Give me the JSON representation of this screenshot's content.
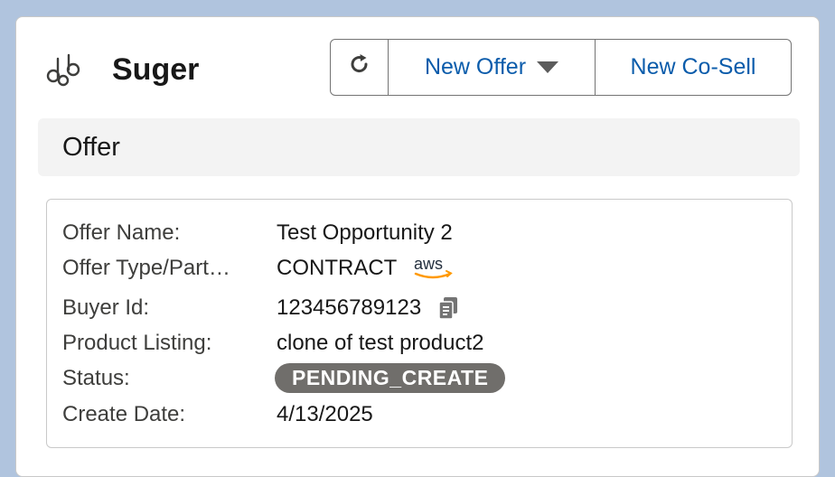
{
  "app": {
    "title": "Suger",
    "logo_icon": "suger-logo-icon"
  },
  "toolbar": {
    "refresh_icon": "refresh-icon",
    "new_offer_label": "New Offer",
    "new_offer_dropdown_icon": "caret-down-icon",
    "new_cosell_label": "New Co-Sell"
  },
  "section": {
    "title": "Offer"
  },
  "details": {
    "offer_name_label": "Offer Name:",
    "offer_name_value": "Test Opportunity 2",
    "offer_type_label": "Offer Type/Part…",
    "offer_type_value": "CONTRACT",
    "partner_logo": "aws-logo-icon",
    "buyer_id_label": "Buyer Id:",
    "buyer_id_value": "123456789123",
    "copy_icon": "copy-icon",
    "product_listing_label": "Product Listing:",
    "product_listing_value": "clone of test product2",
    "status_label": "Status:",
    "status_value": "PENDING_CREATE",
    "create_date_label": "Create Date:",
    "create_date_value": "4/13/2025"
  },
  "colors": {
    "background": "#b0c4de",
    "link": "#0b5cab",
    "badge": "#706e6b",
    "aws_orange": "#ff9900"
  }
}
